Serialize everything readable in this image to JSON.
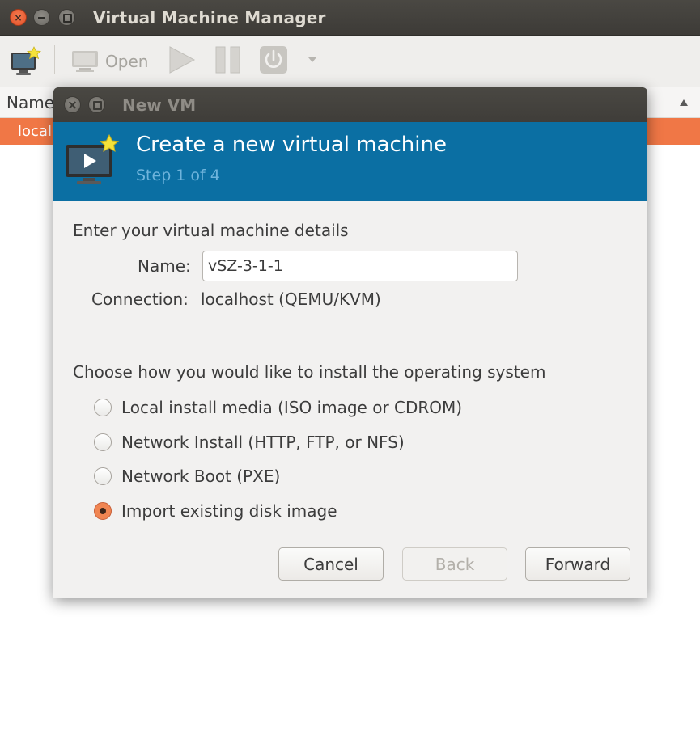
{
  "window": {
    "title": "Virtual Machine Manager",
    "close_glyph": "×",
    "min_glyph": "",
    "max_glyph": ""
  },
  "toolbar": {
    "new_vm_icon": "new-vm-monitor-icon",
    "open_label": "Open",
    "play_icon": "play-icon",
    "pause_icon": "pause-icon",
    "power_icon": "power-icon",
    "dropdown_icon": "chevron-down-icon"
  },
  "list": {
    "column_name": "Name",
    "rows": [
      {
        "label": "local"
      }
    ]
  },
  "dialog": {
    "title": "New VM",
    "header_title": "Create a new virtual machine",
    "header_step": "Step 1 of 4",
    "details_heading": "Enter your virtual machine details",
    "name_label": "Name:",
    "name_value": "vSZ-3-1-1",
    "connection_label": "Connection:",
    "connection_value": "localhost (QEMU/KVM)",
    "install_heading": "Choose how you would like to install the operating system",
    "install_options": [
      {
        "label": "Local install media (ISO image or CDROM)",
        "checked": false
      },
      {
        "label": "Network Install (HTTP, FTP, or NFS)",
        "checked": false
      },
      {
        "label": "Network Boot (PXE)",
        "checked": false
      },
      {
        "label": "Import existing disk image",
        "checked": true
      }
    ],
    "buttons": {
      "cancel": "Cancel",
      "back": "Back",
      "forward": "Forward"
    }
  },
  "colors": {
    "banner": "#0b6fa3",
    "selection": "#f07746",
    "radio_checked": "#f08552"
  }
}
